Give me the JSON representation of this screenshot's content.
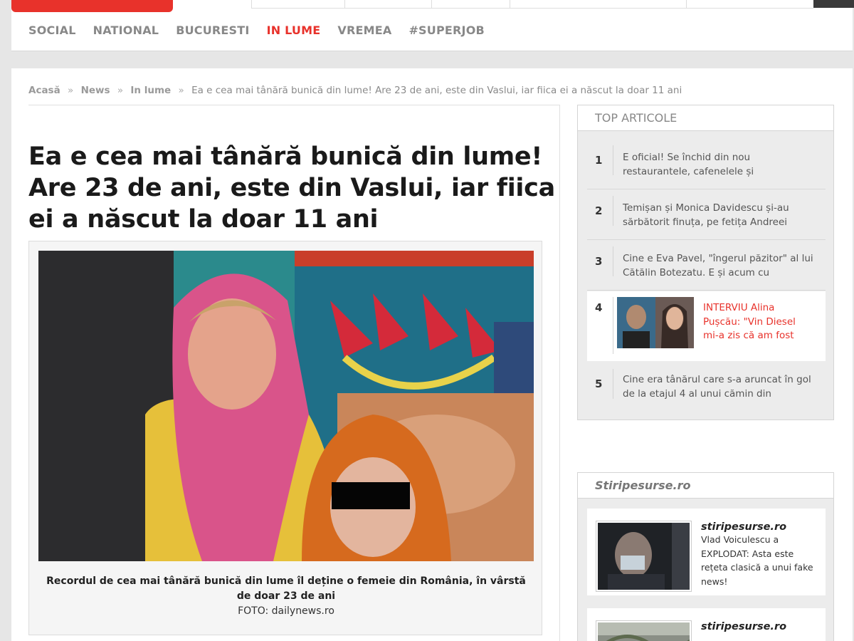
{
  "nav": {
    "items": [
      {
        "label": "SOCIAL",
        "active": false
      },
      {
        "label": "NATIONAL",
        "active": false
      },
      {
        "label": "BUCURESTI",
        "active": false
      },
      {
        "label": "IN LUME",
        "active": true
      },
      {
        "label": "VREMEA",
        "active": false
      },
      {
        "label": "#SUPERJOB",
        "active": false
      }
    ]
  },
  "breadcrumb": {
    "items": [
      "Acasă",
      "News",
      "In lume"
    ],
    "separator": "»",
    "current": "Ea e cea mai tânără bunică din lume! Are 23 de ani, este din Vaslui, iar fiica ei a născut la doar 11 ani"
  },
  "article": {
    "headline": "Ea e cea mai tânără bunică din lume! Are 23 de ani, este din Vaslui, iar fiica ei a născut la doar 11 ani",
    "caption": "Recordul de cea mai tânără bunică din lume îl deține o femeie din România, în vârstă de doar 23 de ani",
    "photo_credit": "FOTO: dailynews.ro"
  },
  "top_articole": {
    "title": "TOP ARTICOLE",
    "items": [
      {
        "num": "1",
        "text": "E oficial! Se închid din nou restaurantele, cafenelele și"
      },
      {
        "num": "2",
        "text": "Temișan și Monica Davidescu și-au sărbătorit finuța, pe fetița Andreei"
      },
      {
        "num": "3",
        "text": "Cine e Eva Pavel, \"îngerul păzitor\" al lui Cătălin Botezatu. E și acum cu"
      },
      {
        "num": "4",
        "text": "INTERVIU Alina Pușcău: \"Vin Diesel mi-a zis că am fost"
      },
      {
        "num": "5",
        "text": "Cine era tânărul care s-a aruncat în gol de la etajul 4 al unui cămin din"
      }
    ]
  },
  "stiripesurse": {
    "title": "Stiripesurse.ro",
    "items": [
      {
        "source": "stiripesurse.ro",
        "text": "Vlad Voiculescu a EXPLODAT: Asta este rețeta clasică a unui fake news!"
      },
      {
        "source": "stiripesurse.ro",
        "text": ""
      }
    ]
  },
  "colors": {
    "accent": "#e8322b",
    "nav_inactive": "#888888",
    "link_red": "#e8322b"
  }
}
